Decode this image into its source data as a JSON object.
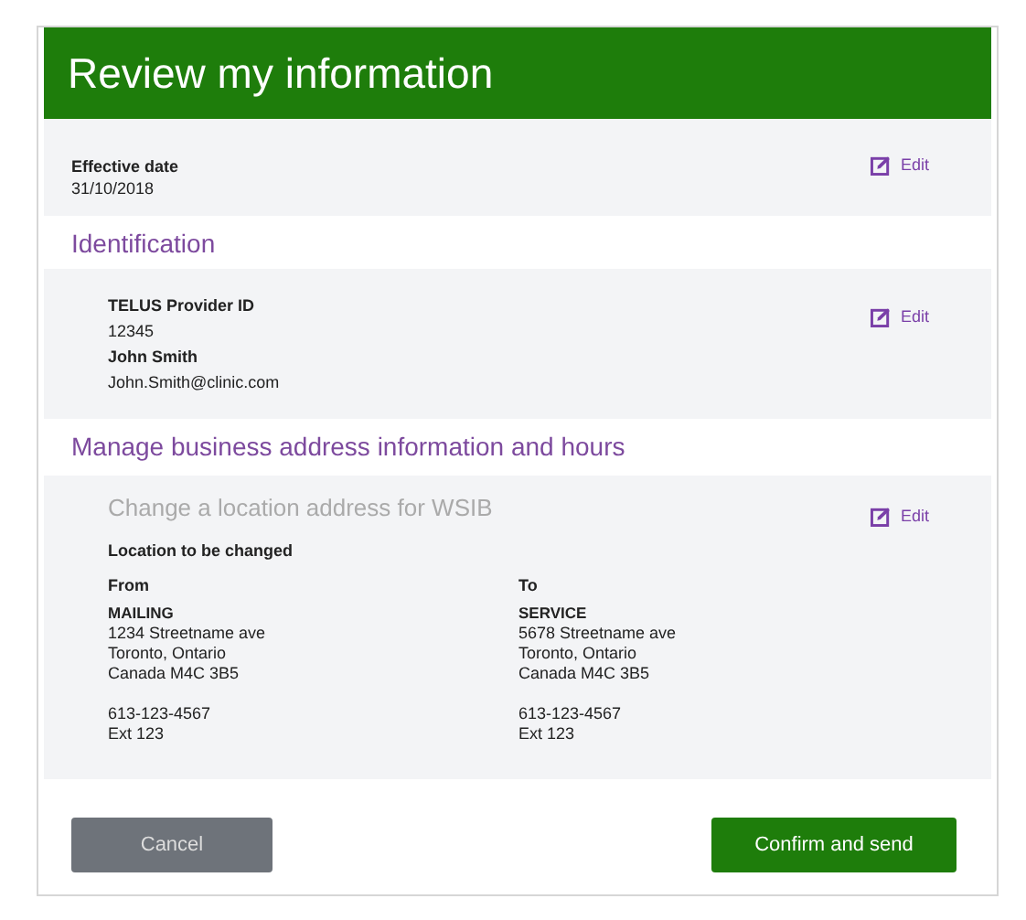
{
  "header": {
    "title": "Review my information"
  },
  "effective_date": {
    "label": "Effective date",
    "value": "31/10/2018",
    "edit": "Edit"
  },
  "identification": {
    "heading": "Identification",
    "edit": "Edit",
    "lines": [
      {
        "text": "TELUS Provider ID",
        "bold": true
      },
      {
        "text": "12345",
        "bold": false
      },
      {
        "text": "John Smith",
        "bold": true
      },
      {
        "text": "John.Smith@clinic.com",
        "bold": false
      }
    ]
  },
  "address": {
    "heading": "Manage business address information and hours",
    "subheading": "Change a location address for WSIB",
    "edit": "Edit",
    "location_label": "Location to be changed",
    "columns": [
      {
        "title": "From",
        "type": "MAILING",
        "lines": [
          "1234 Streetname ave",
          "Toronto, Ontario",
          "Canada M4C 3B5"
        ],
        "phone": "613-123-4567",
        "ext": "Ext 123"
      },
      {
        "title": "To",
        "type": "SERVICE",
        "lines": [
          "5678 Streetname ave",
          "Toronto, Ontario",
          "Canada M4C 3B5"
        ],
        "phone": "613-123-4567",
        "ext": "Ext 123"
      }
    ]
  },
  "buttons": [
    {
      "label": "Cancel",
      "kind": "secondary"
    },
    {
      "label": "Confirm and send",
      "kind": "primary"
    }
  ]
}
